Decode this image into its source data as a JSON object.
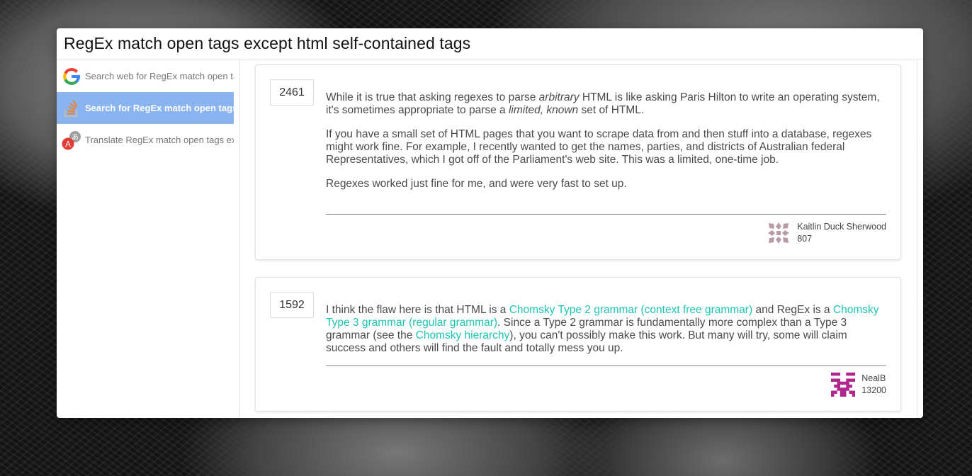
{
  "window": {
    "title": "RegEx match open tags except html self-contained tags"
  },
  "sidebar": {
    "items": [
      {
        "label": "Search web for RegEx match open tags except html self-contained tags",
        "icon": "google-icon",
        "active": false
      },
      {
        "label": "Search for RegEx match open tags except html self-contained tags",
        "icon": "stackoverflow-icon",
        "active": true
      },
      {
        "label": "Translate RegEx match open tags except html self-contained tags",
        "icon": "translate-icon",
        "active": false
      }
    ]
  },
  "answers": [
    {
      "votes": "2461",
      "paragraphs": [
        [
          {
            "t": "While it is true that asking regexes to parse "
          },
          {
            "t": "arbitrary",
            "em": true
          },
          {
            "t": " HTML is like asking Paris Hilton to write an operating system, it's sometimes appropriate to parse a "
          },
          {
            "t": "limited, known",
            "em": true
          },
          {
            "t": " set of HTML."
          }
        ],
        [
          {
            "t": "If you have a small set of HTML pages that you want to scrape data from and then stuff into a database, regexes might work fine. For example, I recently wanted to get the names, parties, and districts of Australian federal Representatives, which I got off of the Parliament's web site. This was a limited, one-time job."
          }
        ],
        [
          {
            "t": "Regexes worked just fine for me, and were very fast to set up."
          }
        ]
      ],
      "author": {
        "name": "Kaitlin Duck Sherwood",
        "reputation": "807",
        "avatar_color": "#b89aa8"
      }
    },
    {
      "votes": "1592",
      "paragraphs": [
        [
          {
            "t": "I think the flaw here is that HTML is a "
          },
          {
            "t": "Chomsky Type 2 grammar (context free grammar)",
            "link": true
          },
          {
            "t": " and RegEx is a "
          },
          {
            "t": "Chomsky Type 3 grammar (regular grammar)",
            "link": true
          },
          {
            "t": ". Since a Type 2 grammar is fundamentally more complex than a Type 3 grammar (see the "
          },
          {
            "t": "Chomsky hierarchy",
            "link": true
          },
          {
            "t": "), you can't possibly make this work. But many will try, some will claim success and others will find the fault and totally mess you up."
          }
        ]
      ],
      "author": {
        "name": "NealB",
        "reputation": "13200",
        "avatar_color": "#b0268c"
      }
    }
  ],
  "colors": {
    "accent": "#8ab4f0",
    "link": "#1ec4b2"
  }
}
